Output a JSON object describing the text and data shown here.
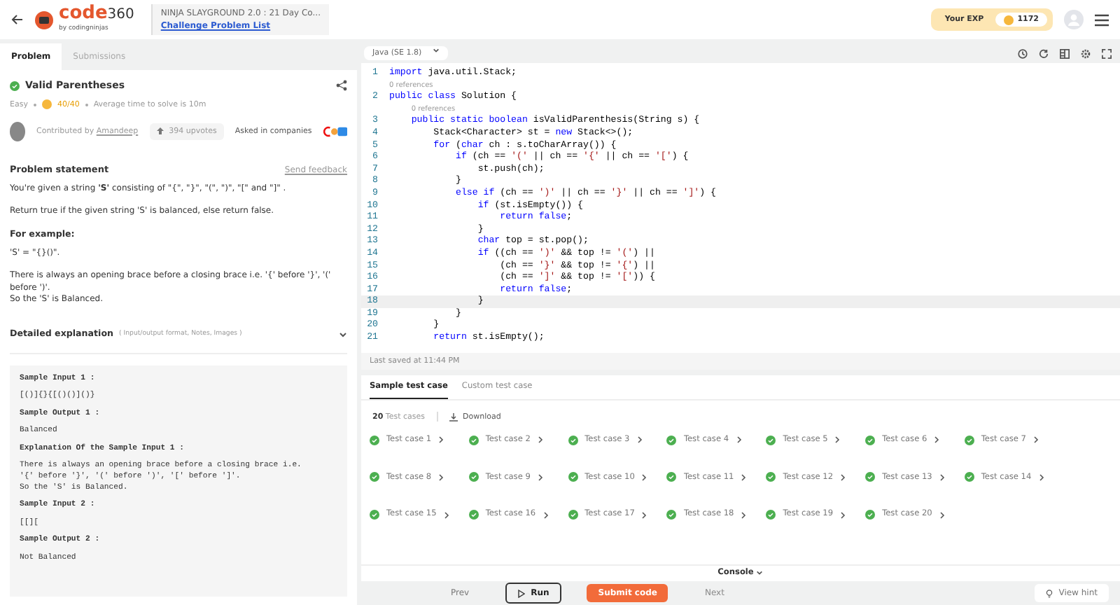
{
  "header": {
    "logo_word": "code",
    "logo_number": "360",
    "logo_sub": "by codingninjas",
    "event_title": "NINJA SLAYGROUND 2.0 : 21 Day Co...",
    "event_link": "Challenge Problem List",
    "exp_label": "Your EXP",
    "exp_value": "1172"
  },
  "problem_tabs": [
    {
      "label": "Problem",
      "selected": true
    },
    {
      "label": "Submissions",
      "selected": false
    }
  ],
  "problem": {
    "title": "Valid Parentheses",
    "solved": true,
    "difficulty": "Easy",
    "score": "40/40",
    "avg_time": "Average time to solve is 10m",
    "contributed_label": "Contributed by",
    "contributor": "Amandeep",
    "upvotes": "394 upvotes",
    "companies_label": "Asked in companies",
    "statement_heading": "Problem statement",
    "feedback_link": "Send feedback",
    "paragraphs": [
      "You're given a string **'S'** consisting of \"{\", \"}\", \"(\", \")\", \"[\" and \"]\" .",
      "Return true if the given string 'S' is balanced, else return false."
    ],
    "example_heading": "For example:",
    "example_lines": [
      "'S' = \"{}()\".",
      "There is always an opening brace before a closing brace i.e. '{' before '}', '(' before ')'.\nSo the 'S' is Balanced."
    ],
    "explanation_heading": "Detailed explanation",
    "explanation_hint": "( Input/output format, Notes, Images )",
    "samples": [
      {
        "kind": "heading",
        "text": "Sample Input 1 :"
      },
      {
        "kind": "text",
        "text": "[()]{}{[()()]()}"
      },
      {
        "kind": "heading",
        "text": "Sample Output 1 :"
      },
      {
        "kind": "text",
        "text": "Balanced"
      },
      {
        "kind": "heading",
        "text": "Explanation Of the Sample Input 1 :"
      },
      {
        "kind": "text",
        "text": "There is always an opening brace before a closing brace i.e.\n'{' before '}', '(' before ')', '[' before ']'.\nSo the 'S' is Balanced."
      },
      {
        "kind": "heading",
        "text": "Sample Input 2 :"
      },
      {
        "kind": "text",
        "text": "[[]["
      },
      {
        "kind": "heading",
        "text": "Sample Output 2 :"
      },
      {
        "kind": "text",
        "text": "Not Balanced"
      }
    ]
  },
  "editor": {
    "language": "Java (SE 1.8)",
    "saved": "Last saved at 11:44 PM",
    "lines": [
      {
        "kind": "code",
        "number": "1",
        "current": false,
        "segments": [
          {
            "kind": "kw",
            "text": "import"
          },
          {
            "kind": "plain",
            "text": " java.util.Stack;"
          }
        ]
      },
      {
        "kind": "lens",
        "text": "0 references"
      },
      {
        "kind": "code",
        "number": "2",
        "current": false,
        "segments": [
          {
            "kind": "kw",
            "text": "public class"
          },
          {
            "kind": "plain",
            "text": " Solution {"
          }
        ]
      },
      {
        "kind": "lens",
        "text": "0 references"
      },
      {
        "kind": "code",
        "number": "3",
        "current": false,
        "segments": [
          {
            "kind": "kw",
            "text": "    public static boolean"
          },
          {
            "kind": "plain",
            "text": " isValidParenthesis(String s) {"
          }
        ]
      },
      {
        "kind": "code",
        "number": "4",
        "current": false,
        "segments": [
          {
            "kind": "plain",
            "text": "        Stack<Character> st = "
          },
          {
            "kind": "kw",
            "text": "new"
          },
          {
            "kind": "plain",
            "text": " Stack<>();"
          }
        ]
      },
      {
        "kind": "code",
        "number": "5",
        "current": false,
        "segments": [
          {
            "kind": "kw",
            "text": "        for"
          },
          {
            "kind": "plain",
            "text": " ("
          },
          {
            "kind": "kw",
            "text": "char"
          },
          {
            "kind": "plain",
            "text": " ch : s.toCharArray()) {"
          }
        ]
      },
      {
        "kind": "code",
        "number": "6",
        "current": false,
        "segments": [
          {
            "kind": "kw",
            "text": "            if"
          },
          {
            "kind": "plain",
            "text": " (ch == "
          },
          {
            "kind": "str",
            "text": "'('"
          },
          {
            "kind": "plain",
            "text": " || ch == "
          },
          {
            "kind": "str",
            "text": "'{'"
          },
          {
            "kind": "plain",
            "text": " || ch == "
          },
          {
            "kind": "str",
            "text": "'['"
          },
          {
            "kind": "plain",
            "text": ") {"
          }
        ]
      },
      {
        "kind": "code",
        "number": "7",
        "current": false,
        "segments": [
          {
            "kind": "plain",
            "text": "                st.push(ch);"
          }
        ]
      },
      {
        "kind": "code",
        "number": "8",
        "current": false,
        "segments": [
          {
            "kind": "plain",
            "text": "            }"
          }
        ]
      },
      {
        "kind": "code",
        "number": "9",
        "current": false,
        "segments": [
          {
            "kind": "kw",
            "text": "            else if"
          },
          {
            "kind": "plain",
            "text": " (ch == "
          },
          {
            "kind": "str",
            "text": "')'"
          },
          {
            "kind": "plain",
            "text": " || ch == "
          },
          {
            "kind": "str",
            "text": "'}'"
          },
          {
            "kind": "plain",
            "text": " || ch == "
          },
          {
            "kind": "str",
            "text": "']'"
          },
          {
            "kind": "plain",
            "text": ") {"
          }
        ]
      },
      {
        "kind": "code",
        "number": "10",
        "current": false,
        "segments": [
          {
            "kind": "kw",
            "text": "                if"
          },
          {
            "kind": "plain",
            "text": " (st.isEmpty()) {"
          }
        ]
      },
      {
        "kind": "code",
        "number": "11",
        "current": false,
        "segments": [
          {
            "kind": "kw",
            "text": "                    return false"
          },
          {
            "kind": "plain",
            "text": ";"
          }
        ]
      },
      {
        "kind": "code",
        "number": "12",
        "current": false,
        "segments": [
          {
            "kind": "plain",
            "text": "                }"
          }
        ]
      },
      {
        "kind": "code",
        "number": "13",
        "current": false,
        "segments": [
          {
            "kind": "kw",
            "text": "                char"
          },
          {
            "kind": "plain",
            "text": " top = st.pop();"
          }
        ]
      },
      {
        "kind": "code",
        "number": "14",
        "current": false,
        "segments": [
          {
            "kind": "kw",
            "text": "                if"
          },
          {
            "kind": "plain",
            "text": " ((ch == "
          },
          {
            "kind": "str",
            "text": "')'"
          },
          {
            "kind": "plain",
            "text": " && top != "
          },
          {
            "kind": "str",
            "text": "'('"
          },
          {
            "kind": "plain",
            "text": ") ||"
          }
        ]
      },
      {
        "kind": "code",
        "number": "15",
        "current": false,
        "segments": [
          {
            "kind": "plain",
            "text": "                    (ch == "
          },
          {
            "kind": "str",
            "text": "'}'"
          },
          {
            "kind": "plain",
            "text": " && top != "
          },
          {
            "kind": "str",
            "text": "'{'"
          },
          {
            "kind": "plain",
            "text": ") ||"
          }
        ]
      },
      {
        "kind": "code",
        "number": "16",
        "current": false,
        "segments": [
          {
            "kind": "plain",
            "text": "                    (ch == "
          },
          {
            "kind": "str",
            "text": "']'"
          },
          {
            "kind": "plain",
            "text": " && top != "
          },
          {
            "kind": "str",
            "text": "'['"
          },
          {
            "kind": "plain",
            "text": ")) {"
          }
        ]
      },
      {
        "kind": "code",
        "number": "17",
        "current": false,
        "segments": [
          {
            "kind": "kw",
            "text": "                    return false"
          },
          {
            "kind": "plain",
            "text": ";"
          }
        ]
      },
      {
        "kind": "code",
        "number": "18",
        "current": true,
        "segments": [
          {
            "kind": "plain",
            "text": "                }"
          }
        ]
      },
      {
        "kind": "code",
        "number": "19",
        "current": false,
        "segments": [
          {
            "kind": "plain",
            "text": "            }"
          }
        ]
      },
      {
        "kind": "code",
        "number": "20",
        "current": false,
        "segments": [
          {
            "kind": "plain",
            "text": "        }"
          }
        ]
      },
      {
        "kind": "code",
        "number": "21",
        "current": false,
        "segments": [
          {
            "kind": "kw",
            "text": "        return"
          },
          {
            "kind": "plain",
            "text": " st.isEmpty();"
          }
        ]
      }
    ]
  },
  "test_tabs": [
    {
      "label": "Sample test case",
      "selected": true
    },
    {
      "label": "Custom test case",
      "selected": false
    }
  ],
  "tests": {
    "count": "20",
    "count_label": "Test cases",
    "download": "Download",
    "cases": [
      {
        "label": "Test case 1",
        "passed": true
      },
      {
        "label": "Test case 2",
        "passed": true
      },
      {
        "label": "Test case 3",
        "passed": true
      },
      {
        "label": "Test case 4",
        "passed": true
      },
      {
        "label": "Test case 5",
        "passed": true
      },
      {
        "label": "Test case 6",
        "passed": true
      },
      {
        "label": "Test case 7",
        "passed": true
      },
      {
        "label": "Test case 8",
        "passed": true
      },
      {
        "label": "Test case 9",
        "passed": true
      },
      {
        "label": "Test case 10",
        "passed": true
      },
      {
        "label": "Test case 11",
        "passed": true
      },
      {
        "label": "Test case 12",
        "passed": true
      },
      {
        "label": "Test case 13",
        "passed": true
      },
      {
        "label": "Test case 14",
        "passed": true
      },
      {
        "label": "Test case 15",
        "passed": true
      },
      {
        "label": "Test case 16",
        "passed": true
      },
      {
        "label": "Test case 17",
        "passed": true
      },
      {
        "label": "Test case 18",
        "passed": true
      },
      {
        "label": "Test case 19",
        "passed": true
      },
      {
        "label": "Test case 20",
        "passed": true
      }
    ]
  },
  "console": "Console",
  "footer": {
    "prev": "Prev",
    "run": "Run",
    "submit": "Submit code",
    "next": "Next",
    "next_disabled": true,
    "hint": "View hint"
  }
}
